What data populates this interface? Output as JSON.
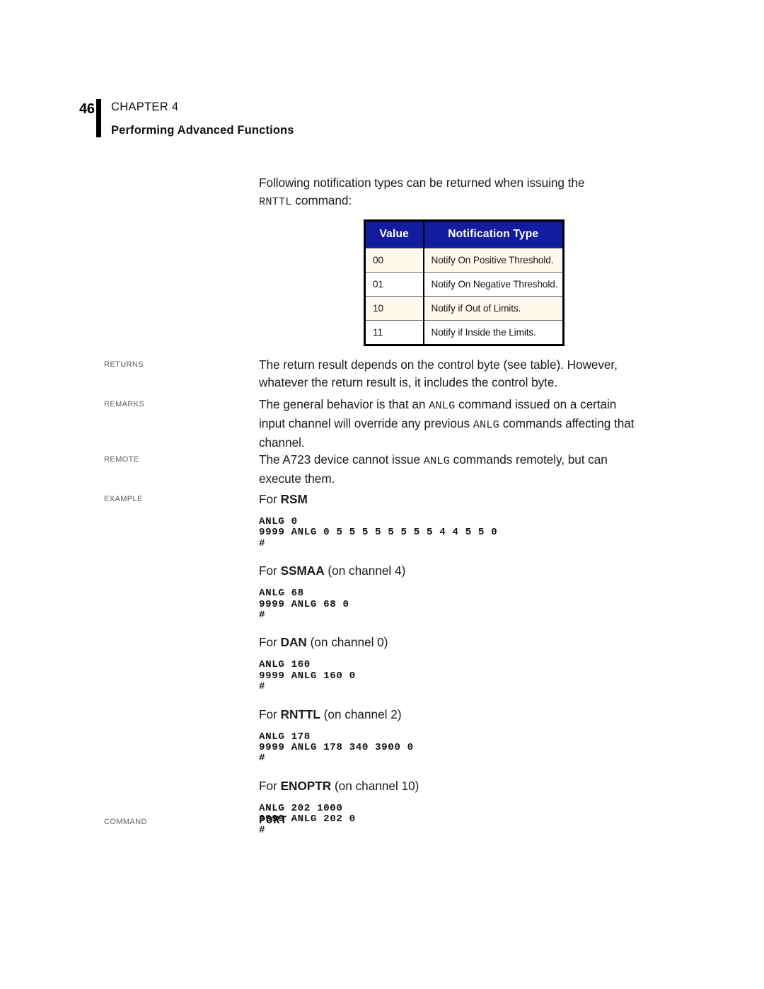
{
  "header": {
    "folio": "46",
    "chapter": "CHAPTER 4",
    "title": "Performing Advanced Functions"
  },
  "intro": {
    "line1": "Following notification types can be returned when issuing the",
    "command": "RNTTL",
    "line2_tail": " command:"
  },
  "table": {
    "columns": [
      "Value",
      "Notification Type"
    ],
    "rows": [
      {
        "value": "00",
        "type": "Notify On Positive Threshold."
      },
      {
        "value": "01",
        "type": "Notify On Negative Threshold."
      },
      {
        "value": "10",
        "type": "Notify if Out of Limits."
      },
      {
        "value": "11",
        "type": "Notify if Inside the Limits."
      }
    ],
    "header_bg": "#131C9E",
    "alt_row_bg": "#FCFAEC"
  },
  "sections": {
    "returns": {
      "label": "Returns",
      "text": "The return result depends on the control byte (see table). However, whatever the return result is, it includes the control byte."
    },
    "remarks": {
      "label": "Remarks",
      "text_a": "The general behavior is that an ",
      "mono_a": "ANLG",
      "text_b": " command issued on a certain input channel will override any previous ",
      "mono_b": "ANLG",
      "text_c": " commands affecting that channel."
    },
    "remote": {
      "label": "Remote",
      "text_a": "The A723 device cannot issue ",
      "mono_a": "ANLG",
      "text_b": " commands remotely, but can execute them."
    },
    "example": {
      "label": "Example",
      "blocks": [
        {
          "lead_prefix": "For ",
          "lead_name": "RSM",
          "lead_suffix": "",
          "code": "ANLG 0\n9999 ANLG 0 5 5 5 5 5 5 5 5 4 4 5 5 0\n#"
        },
        {
          "lead_prefix": "For ",
          "lead_name": "SSMAA",
          "lead_suffix": " (on channel 4)",
          "code": "ANLG 68\n9999 ANLG 68 0\n#"
        },
        {
          "lead_prefix": "For ",
          "lead_name": "DAN",
          "lead_suffix": " (on channel 0)",
          "code": "ANLG 160\n9999 ANLG 160 0\n#"
        },
        {
          "lead_prefix": "For ",
          "lead_name": "RNTTL",
          "lead_suffix": " (on channel 2)",
          "code": "ANLG 178\n9999 ANLG 178 340 3900 0\n#"
        },
        {
          "lead_prefix": "For ",
          "lead_name": "ENOPTR",
          "lead_suffix": " (on channel 10)",
          "code": "ANLG 202 1000\n9999 ANLG 202 0\n#"
        }
      ]
    },
    "command": {
      "label": "Command",
      "name": "PORT"
    }
  }
}
